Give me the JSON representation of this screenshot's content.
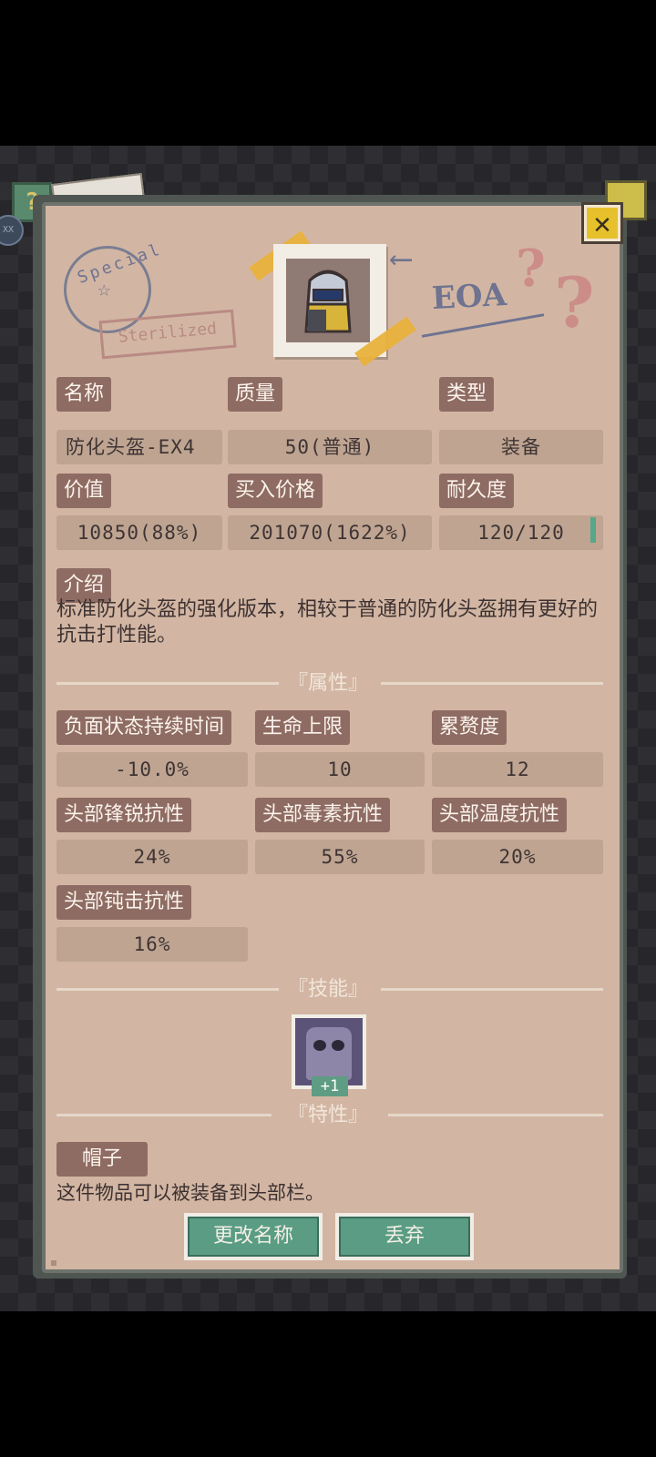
{
  "header": {
    "help_icon": "?",
    "side_badge": "XX",
    "close_icon": "✕"
  },
  "decor": {
    "stamp_text": "Special",
    "stamp_star": "☆",
    "sterilized_text": "Sterilized",
    "eoa_text": "EOA",
    "question_marks": [
      "?",
      "?"
    ],
    "arrow": "⟵"
  },
  "item": {
    "fields": [
      {
        "label": "名称",
        "value": "防化头盔-EX4"
      },
      {
        "label": "质量",
        "value": "50(普通)"
      },
      {
        "label": "类型",
        "value": "装备"
      },
      {
        "label": "价值",
        "value": "10850(88%)"
      },
      {
        "label": "买入价格",
        "value": "201070(1622%)"
      },
      {
        "label": "耐久度",
        "value": "120/120"
      }
    ],
    "durability_fraction": 1.0,
    "description_label": "介绍",
    "description": "标准防化头盔的强化版本，相较于普通的防化头盔拥有更好的抗击打性能。"
  },
  "sections": {
    "attributes_title": "『属性』",
    "skills_title": "『技能』",
    "traits_title": "『特性』"
  },
  "attributes": [
    {
      "label": "负面状态持续时间",
      "value": "-10.0%"
    },
    {
      "label": "生命上限",
      "value": "10"
    },
    {
      "label": "累赘度",
      "value": "12"
    },
    {
      "label": "头部锋锐抗性",
      "value": "24%"
    },
    {
      "label": "头部毒素抗性",
      "value": "55%"
    },
    {
      "label": "头部温度抗性",
      "value": "20%"
    },
    {
      "label": "头部钝击抗性",
      "value": "16%"
    }
  ],
  "skill": {
    "icon": "gas-mask-face-icon",
    "badge": "+1"
  },
  "trait": {
    "label": "帽子",
    "description": "这件物品可以被装备到头部栏。"
  },
  "buttons": {
    "rename": "更改名称",
    "discard": "丢弃"
  },
  "colors": {
    "panel": "#d2b6a3",
    "label_bg": "#8e6c63",
    "value_bg": "#bea491",
    "button": "#5a9c84",
    "close_yellow": "#e7c12c"
  }
}
